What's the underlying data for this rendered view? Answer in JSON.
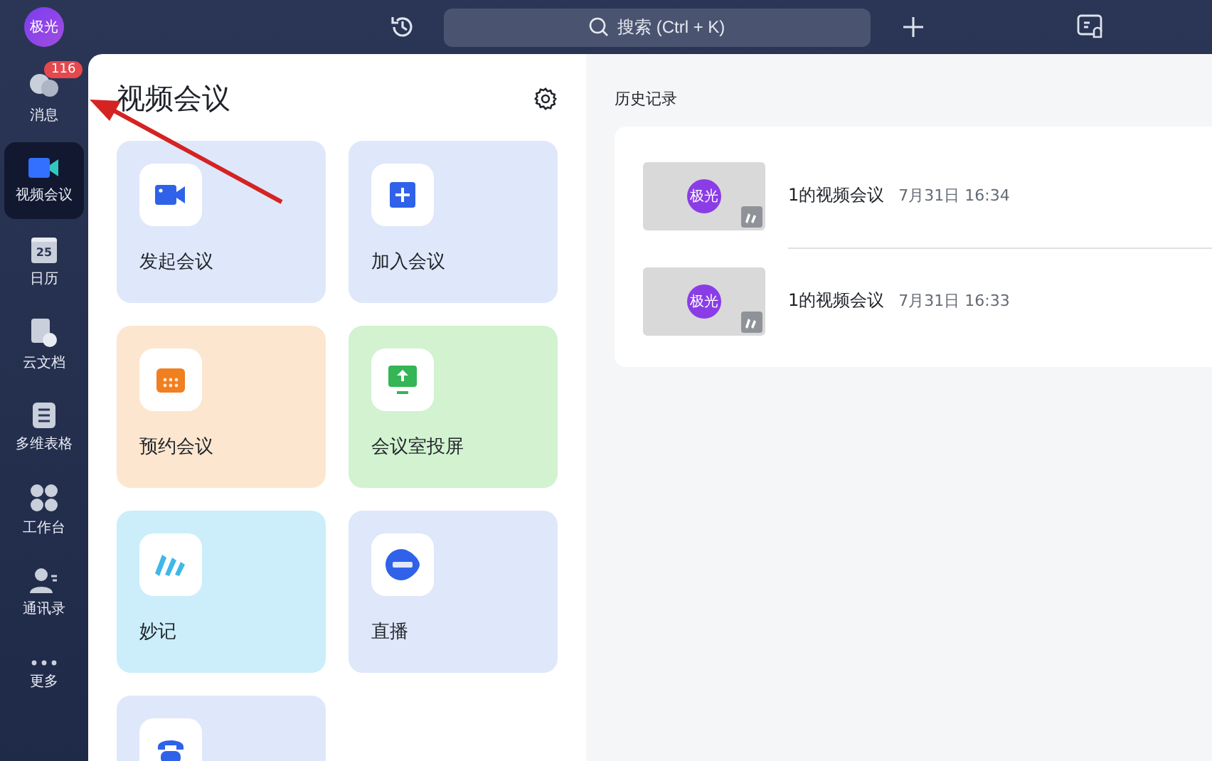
{
  "topbar": {
    "avatar": "极光",
    "search": {
      "placeholder": "搜索 (Ctrl + K)"
    }
  },
  "sidebar": {
    "items": [
      {
        "kind": "chat",
        "label": "消息",
        "badge": "116",
        "selected": false
      },
      {
        "kind": "video",
        "label": "视频会议",
        "selected": true
      },
      {
        "kind": "calendar",
        "label": "日历",
        "icon_text": "25",
        "selected": false
      },
      {
        "kind": "doc",
        "label": "云文档",
        "selected": false
      },
      {
        "kind": "table",
        "label": "多维表格",
        "selected": false
      },
      {
        "kind": "apps",
        "label": "工作台",
        "selected": false
      },
      {
        "kind": "contacts",
        "label": "通讯录",
        "selected": false
      },
      {
        "kind": "more",
        "label": "更多",
        "selected": false
      }
    ]
  },
  "panel": {
    "title": "视频会议",
    "cards": [
      {
        "kind": "video",
        "label": "发起会议",
        "color": "#dfe7fa"
      },
      {
        "kind": "join",
        "label": "加入会议",
        "color": "#dfe7fa"
      },
      {
        "kind": "schedule",
        "label": "预约会议",
        "color": "#fde6cf"
      },
      {
        "kind": "screen",
        "label": "会议室投屏",
        "color": "#d2f2d0"
      },
      {
        "kind": "notes",
        "label": "妙记",
        "color": "#cbeefa"
      },
      {
        "kind": "live",
        "label": "直播",
        "color": "#dfe7fa"
      },
      {
        "kind": "phone",
        "color": "#dfe7fa"
      }
    ]
  },
  "history": {
    "title": "历史记录",
    "records": [
      {
        "avatar": "极光",
        "name": "1的视频会议",
        "time": "7月31日 16:34"
      },
      {
        "avatar": "极光",
        "name": "1的视频会议",
        "time": "7月31日 16:33"
      }
    ]
  }
}
